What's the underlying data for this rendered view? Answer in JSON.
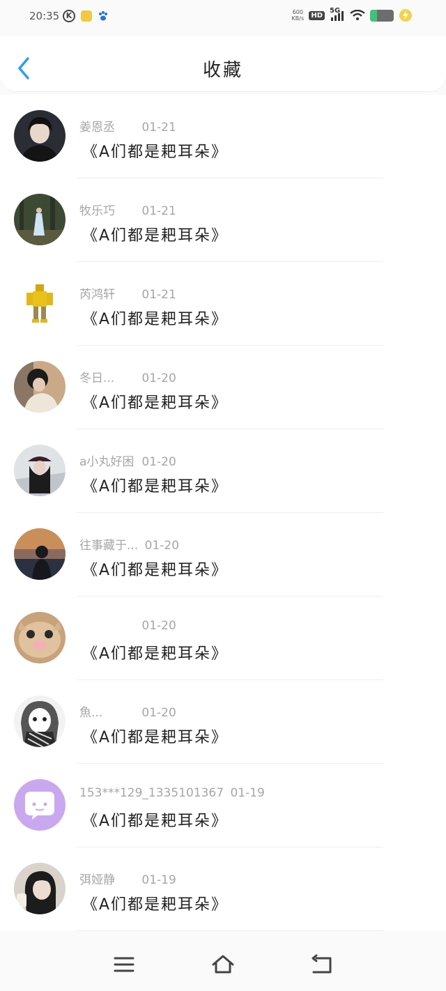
{
  "status_bar": {
    "time": "20:35",
    "speed_top": "600",
    "speed_bottom": "KB/s",
    "hd": "HD",
    "network": "5G",
    "icons": [
      "k-circle-icon",
      "app-icon-yellow",
      "baidu-paw-icon",
      "wifi-icon",
      "battery-icon",
      "charging-bolt-icon"
    ]
  },
  "header": {
    "title": "收藏",
    "back_icon": "chevron-left-icon",
    "accent_color": "#2a9df4"
  },
  "favorites": [
    {
      "name": "姜恩丞",
      "date": "01-21",
      "title": "《A们都是耙耳朵》",
      "avatar": "photo-dark-hair"
    },
    {
      "name": "牧乐巧",
      "date": "01-21",
      "title": "《A们都是耙耳朵》",
      "avatar": "photo-forest"
    },
    {
      "name": "芮鸿轩",
      "date": "01-21",
      "title": "《A们都是耙耳朵》",
      "avatar": "robot-yellow"
    },
    {
      "name": "冬日...",
      "date": "01-20",
      "title": "《A们都是耙耳朵》",
      "avatar": "photo-curly-hair"
    },
    {
      "name": "a小丸好困",
      "date": "01-20",
      "title": "《A们都是耙耳朵》",
      "avatar": "photo-girl-hat"
    },
    {
      "name": "往事藏于...",
      "date": "01-20",
      "title": "《A们都是耙耳朵》",
      "avatar": "photo-sunset"
    },
    {
      "name": "",
      "date": "01-20",
      "title": "《A们都是耙耳朵》",
      "avatar": "photo-cat"
    },
    {
      "name": "魚...",
      "date": "01-20",
      "title": "《A们都是耙耳朵》",
      "avatar": "manga-girl"
    },
    {
      "name": "153***129_1335101367",
      "date": "01-19",
      "title": "《A们都是耙耳朵》",
      "avatar": "default-chat-avatar"
    },
    {
      "name": "弭娅静",
      "date": "01-19",
      "title": "《A们都是耙耳朵》",
      "avatar": "photo-girl-bangs"
    }
  ],
  "nav": {
    "icons": [
      "menu-icon",
      "home-icon",
      "back-arrow-icon"
    ]
  }
}
